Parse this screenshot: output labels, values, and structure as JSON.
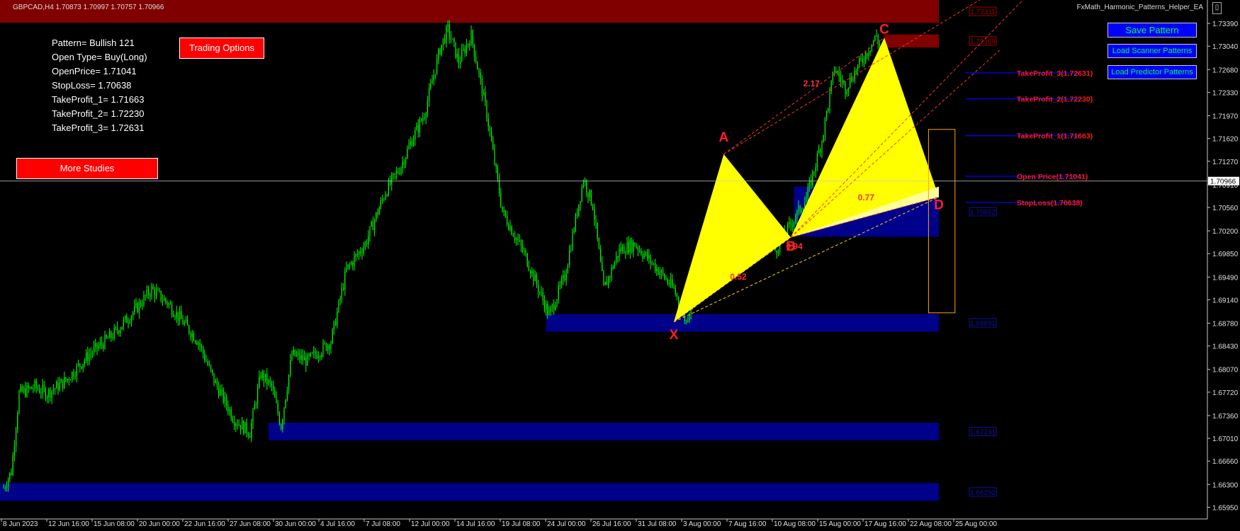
{
  "header": {
    "symbol_info": "GBPCAD,H4  1.70873 1.70997 1.70757 1.70966",
    "ea_name": "FxMath_Harmonic_Patterns_Helper_EA",
    "close_label": "▯"
  },
  "info_panel": {
    "lines": [
      "Pattern= Bullish 121",
      "Open Type= Buy(Long)",
      "OpenPrice= 1.71041",
      "StopLoss= 1.70638",
      "TakeProfit_1= 1.71663",
      "TakeProfit_2= 1.72230",
      "TakeProfit_3= 1.72631"
    ]
  },
  "buttons": {
    "trading_options": "Trading Options",
    "more_studies": "More Studies",
    "save_pattern": "Save Pattern",
    "load_scanner": "Load Scanner Patterns",
    "load_predictor": "Load Predictor Patterns"
  },
  "colors": {
    "background": "#000000",
    "candle": "#00ff00",
    "zone_blue": "#00008b",
    "zone_red": "#800000",
    "pattern_fill": "#ffff00",
    "pattern_fill_light": "#ffff99",
    "level_line": "#0000ff",
    "level_label": "#ff1a1a",
    "fib_line": "#ff3030",
    "base_line": "#ffd700",
    "point_label": "#ff2020",
    "box_outline": "#ffa500"
  },
  "chart_data": {
    "type": "candlestick",
    "symbol": "GBPCAD",
    "timeframe": "H4",
    "ylim": [
      1.6577,
      1.7375
    ],
    "y_ticks": [
      "1.73390",
      "1.73040",
      "1.72680",
      "1.72330",
      "1.71970",
      "1.71620",
      "1.71270",
      "1.70910",
      "1.70560",
      "1.70200",
      "1.69850",
      "1.69490",
      "1.69140",
      "1.68780",
      "1.68430",
      "1.68070",
      "1.67720",
      "1.67360",
      "1.67010",
      "1.66660",
      "1.66300",
      "1.65950"
    ],
    "x_ticks": [
      "8 Jun 2023",
      "12 Jun 16:00",
      "15 Jun 08:00",
      "20 Jun 00:00",
      "22 Jun 16:00",
      "27 Jun 08:00",
      "30 Jun 00:00",
      "4 Jul 16:00",
      "7 Jul 08:00",
      "12 Jul 00:00",
      "14 Jul 16:00",
      "19 Jul 08:00",
      "24 Jul 00:00",
      "26 Jul 16:00",
      "31 Jul 08:00",
      "3 Aug 00:00",
      "7 Aug 16:00",
      "10 Aug 08:00",
      "15 Aug 00:00",
      "17 Aug 16:00",
      "22 Aug 08:00",
      "25 Aug 00:00"
    ],
    "price_path": [
      [
        0,
        1.6625
      ],
      [
        5,
        1.665
      ],
      [
        10,
        1.677
      ],
      [
        20,
        1.678
      ],
      [
        28,
        1.677
      ],
      [
        40,
        1.679
      ],
      [
        55,
        1.683
      ],
      [
        70,
        1.686
      ],
      [
        85,
        1.69
      ],
      [
        95,
        1.693
      ],
      [
        105,
        1.691
      ],
      [
        115,
        1.688
      ],
      [
        125,
        1.685
      ],
      [
        135,
        1.679
      ],
      [
        148,
        1.673
      ],
      [
        158,
        1.671
      ],
      [
        165,
        1.68
      ],
      [
        172,
        1.678
      ],
      [
        178,
        1.672
      ],
      [
        185,
        1.683
      ],
      [
        195,
        1.682
      ],
      [
        210,
        1.685
      ],
      [
        220,
        1.696
      ],
      [
        232,
        1.7
      ],
      [
        245,
        1.708
      ],
      [
        255,
        1.712
      ],
      [
        262,
        1.716
      ],
      [
        270,
        1.72
      ],
      [
        280,
        1.73
      ],
      [
        285,
        1.733
      ],
      [
        292,
        1.728
      ],
      [
        300,
        1.732
      ],
      [
        310,
        1.72
      ],
      [
        320,
        1.705
      ],
      [
        335,
        1.698
      ],
      [
        350,
        1.689
      ],
      [
        360,
        1.695
      ],
      [
        372,
        1.71
      ],
      [
        378,
        1.706
      ],
      [
        385,
        1.693
      ],
      [
        395,
        1.699
      ],
      [
        405,
        1.7
      ],
      [
        420,
        1.696
      ],
      [
        430,
        1.693
      ],
      [
        438,
        1.688
      ],
      [
        450,
        1.7
      ],
      [
        460,
        1.71
      ],
      [
        470,
        1.705
      ],
      [
        482,
        1.707
      ],
      [
        495,
        1.699
      ],
      [
        505,
        1.703
      ],
      [
        515,
        1.707
      ],
      [
        525,
        1.716
      ],
      [
        533,
        1.727
      ],
      [
        540,
        1.724
      ],
      [
        550,
        1.728
      ],
      [
        560,
        1.732
      ],
      [
        565,
        1.728
      ],
      [
        572,
        1.722
      ],
      [
        580,
        1.714
      ],
      [
        588,
        1.7097
      ]
    ],
    "points": {
      "X": {
        "bar": 430,
        "price": 1.688,
        "label_price": 1.686
      },
      "A": {
        "bar": 462,
        "price": 1.7138,
        "label_price": 1.7164
      },
      "B": {
        "bar": 505,
        "price": 1.701,
        "label_price": 1.6996
      },
      "C": {
        "bar": 565,
        "price": 1.7317,
        "label_price": 1.733
      },
      "D": {
        "bar": 600,
        "price": 1.7072,
        "label_price": 1.706
      }
    },
    "ratios": [
      {
        "label": "0.52",
        "bar": 466,
        "price": 1.6945
      },
      {
        "label": "0.94",
        "bar": 502,
        "price": 1.6992
      },
      {
        "label": "2.17",
        "bar": 513,
        "price": 1.7242
      },
      {
        "label": "0.77",
        "bar": 548,
        "price": 1.7067
      }
    ],
    "levels": [
      {
        "label": "TakeProfit_3(1.72631)",
        "price": 1.72631
      },
      {
        "label": "TakeProfit_2(1.72230)",
        "price": 1.7223
      },
      {
        "label": "TakeProfit_1(1.71663)",
        "price": 1.71663
      },
      {
        "label": "Open Price(1.71041)",
        "price": 1.71041
      },
      {
        "label": "StopLoss(1.70638)",
        "price": 1.70638
      }
    ],
    "zones": [
      {
        "color": "red",
        "from_bar": 0,
        "to_bar": 600,
        "top": 1.7375,
        "bottom": 1.734,
        "tag": "1.73311"
      },
      {
        "color": "red",
        "from_bar": 565,
        "to_bar": 600,
        "top": 1.7322,
        "bottom": 1.7302,
        "tag": "1.72988"
      },
      {
        "color": "blue",
        "from_bar": 507,
        "to_bar": 600,
        "top": 1.7088,
        "bottom": 1.7011,
        "tag": "1.70862"
      },
      {
        "color": "blue",
        "from_bar": 348,
        "to_bar": 600,
        "top": 1.6892,
        "bottom": 1.6865,
        "tag": "1.68891"
      },
      {
        "color": "blue",
        "from_bar": 170,
        "to_bar": 600,
        "top": 1.6725,
        "bottom": 1.6698,
        "tag": "1.67231"
      },
      {
        "color": "blue",
        "from_bar": 0,
        "to_bar": 600,
        "top": 1.6632,
        "bottom": 1.6605,
        "tag": "1.66292"
      }
    ],
    "prz_box": {
      "from_bar": 592,
      "to_bar": 609,
      "top": 1.7176,
      "bottom": 1.6894
    },
    "current_price": {
      "value": 1.70966,
      "label": "1.70966"
    }
  }
}
